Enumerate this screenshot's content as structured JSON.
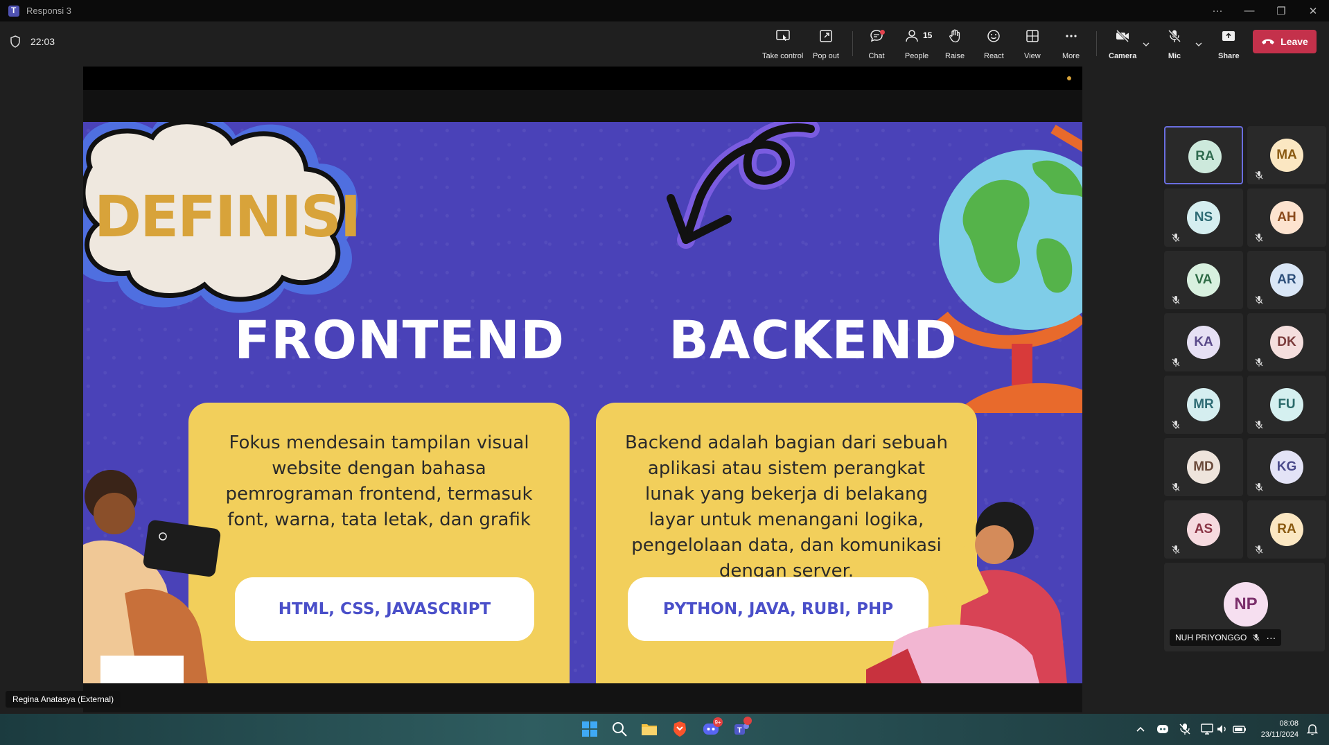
{
  "window": {
    "title": "Responsi 3"
  },
  "toolbar": {
    "timer": "22:03",
    "buttons": {
      "take_control": "Take control",
      "pop_out": "Pop out",
      "chat": "Chat",
      "people": "People",
      "people_count": "15",
      "raise": "Raise",
      "react": "React",
      "view": "View",
      "more": "More",
      "camera": "Camera",
      "mic": "Mic",
      "share": "Share",
      "leave": "Leave"
    }
  },
  "slide": {
    "title": "DEFINISI",
    "frontend": {
      "heading": "FRONTEND",
      "description": "Fokus mendesain tampilan visual website dengan bahasa pemrograman frontend, termasuk font, warna, tata letak, dan grafik",
      "tech": "HTML, CSS, JAVASCRIPT"
    },
    "backend": {
      "heading": "BACKEND",
      "description": "Backend adalah bagian dari sebuah aplikasi atau sistem perangkat lunak yang bekerja di belakang layar untuk menangani logika, pengelolaan data, dan komunikasi dengan server.",
      "tech": "PYTHON, JAVA, RUBI, PHP"
    },
    "colors": {
      "background": "#4a42b8",
      "card": "#f2cf5b",
      "accent": "#d8a33a"
    }
  },
  "presenter": {
    "name": "Regina Anatasya (External)"
  },
  "participants": [
    {
      "initials": "RA",
      "bg": "#cde9dc",
      "fg": "#2f6b4f",
      "muted": false,
      "active": true
    },
    {
      "initials": "MA",
      "bg": "#fbe7c2",
      "fg": "#8a5a12",
      "muted": true
    },
    {
      "initials": "NS",
      "bg": "#d5eef0",
      "fg": "#2f6c75",
      "muted": true
    },
    {
      "initials": "AH",
      "bg": "#fde3cf",
      "fg": "#8a4a1c",
      "muted": true
    },
    {
      "initials": "VA",
      "bg": "#d8f0df",
      "fg": "#2e6b45",
      "muted": true
    },
    {
      "initials": "AR",
      "bg": "#d9e6f6",
      "fg": "#2d4f7a",
      "muted": true
    },
    {
      "initials": "KA",
      "bg": "#e6e0f4",
      "fg": "#5a4a8a",
      "muted": true
    },
    {
      "initials": "DK",
      "bg": "#f4dedd",
      "fg": "#7a3a3a",
      "muted": true
    },
    {
      "initials": "MR",
      "bg": "#d5eef0",
      "fg": "#2f6c75",
      "muted": true
    },
    {
      "initials": "FU",
      "bg": "#d5f0f0",
      "fg": "#2a6a6a",
      "muted": true
    },
    {
      "initials": "MD",
      "bg": "#eee4dc",
      "fg": "#6a4a3a",
      "muted": true
    },
    {
      "initials": "KG",
      "bg": "#e3e3f6",
      "fg": "#4a4a8a",
      "muted": true
    },
    {
      "initials": "AS",
      "bg": "#f6dadf",
      "fg": "#8a3445",
      "muted": true
    },
    {
      "initials": "RA",
      "bg": "#fbe7c2",
      "fg": "#8a5a12",
      "muted": true
    }
  ],
  "featured_participant": {
    "initials": "NP",
    "name": "NUH PRIYONGGO"
  },
  "taskbar": {
    "time": "08:08",
    "date": "23/11/2024",
    "discord_badge": "9+"
  }
}
